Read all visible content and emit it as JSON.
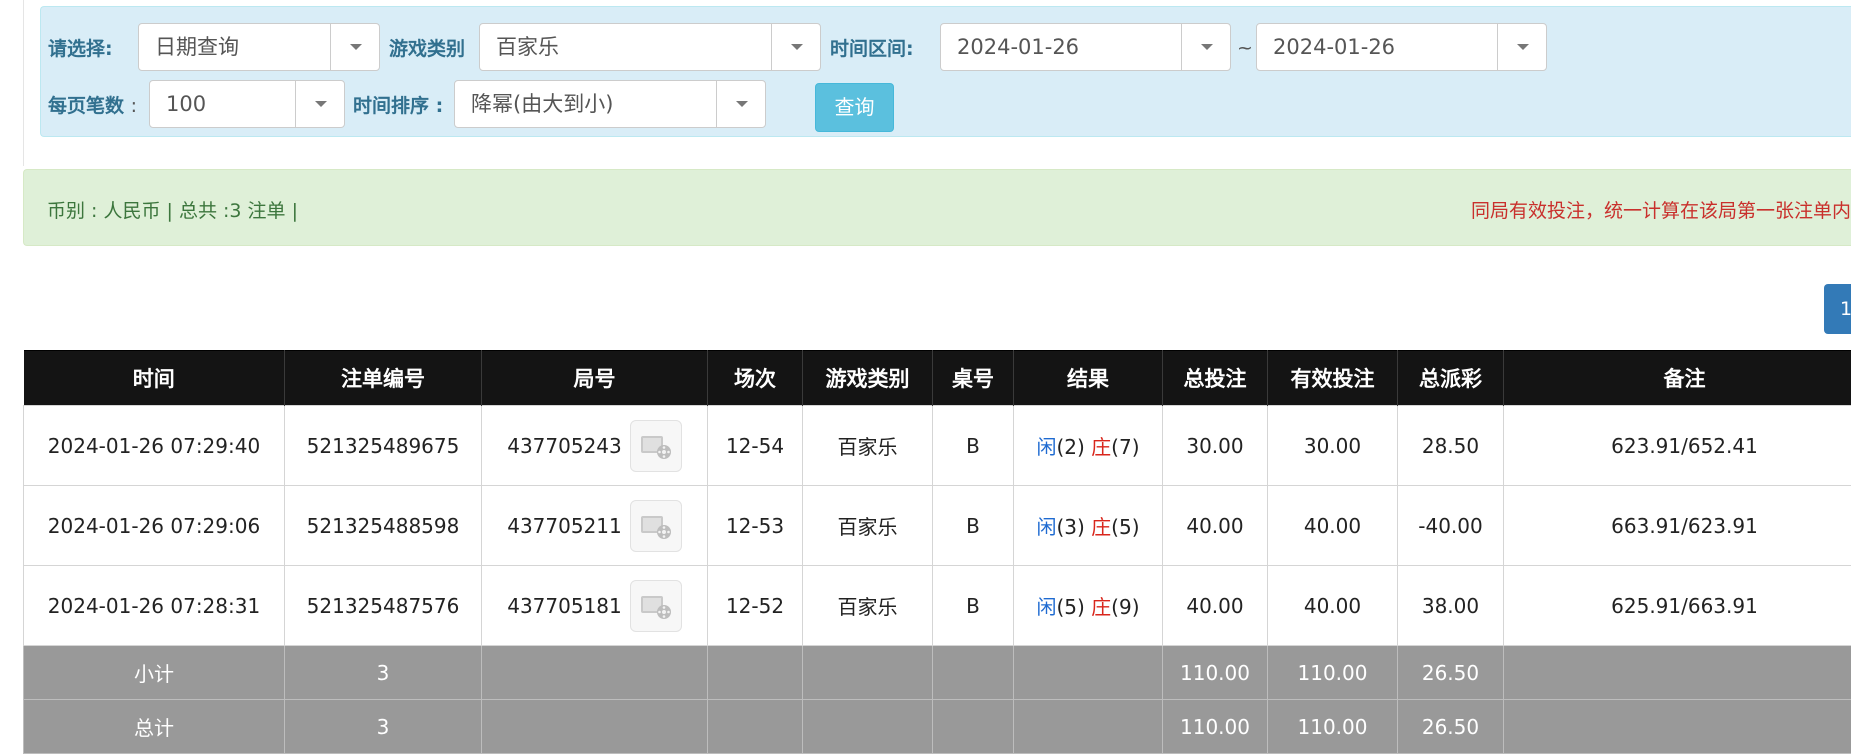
{
  "filters": {
    "select_label": "请选择:",
    "select_value": "日期查询",
    "game_type_label": "游戏类别",
    "game_type_value": "百家乐",
    "time_range_label": "时间区间:",
    "date_from": "2024-01-26",
    "tilde": "~",
    "date_to": "2024-01-26",
    "per_page_label": "每页笔数",
    "per_page_colon": ":",
    "per_page_value": "100",
    "sort_label": "时间排序 :",
    "sort_value": "降幂(由大到小)",
    "query_button": "查询"
  },
  "info": {
    "summary": "币别 : 人民币 | 总共 :3 注单 |",
    "notice": "同局有效投注，统一计算在该局第一张注单内"
  },
  "pagination": {
    "current": "1"
  },
  "table": {
    "headers": [
      "时间",
      "注单编号",
      "局号",
      "场次",
      "游戏类别",
      "桌号",
      "结果",
      "总投注",
      "有效投注",
      "总派彩",
      "备注"
    ],
    "rows": [
      {
        "time": "2024-01-26 07:29:40",
        "bet_id": "521325489675",
        "round_id": "437705243",
        "session": "12-54",
        "game": "百家乐",
        "table": "B",
        "player_label": "闲",
        "player_score": "(2)",
        "banker_label": "庄",
        "banker_score": "(7)",
        "total_bet": "30.00",
        "valid_bet": "30.00",
        "payout": "28.50",
        "note": "623.91/652.41"
      },
      {
        "time": "2024-01-26 07:29:06",
        "bet_id": "521325488598",
        "round_id": "437705211",
        "session": "12-53",
        "game": "百家乐",
        "table": "B",
        "player_label": "闲",
        "player_score": "(3)",
        "banker_label": "庄",
        "banker_score": "(5)",
        "total_bet": "40.00",
        "valid_bet": "40.00",
        "payout": "-40.00",
        "note": "663.91/623.91"
      },
      {
        "time": "2024-01-26 07:28:31",
        "bet_id": "521325487576",
        "round_id": "437705181",
        "session": "12-52",
        "game": "百家乐",
        "table": "B",
        "player_label": "闲",
        "player_score": "(5)",
        "banker_label": "庄",
        "banker_score": "(9)",
        "total_bet": "40.00",
        "valid_bet": "40.00",
        "payout": "38.00",
        "note": "625.91/663.91"
      }
    ],
    "subtotal": {
      "label": "小计",
      "count": "3",
      "total_bet": "110.00",
      "valid_bet": "110.00",
      "payout": "26.50"
    },
    "total": {
      "label": "总计",
      "count": "3",
      "total_bet": "110.00",
      "valid_bet": "110.00",
      "payout": "26.50"
    }
  },
  "icons": {
    "replay": "video-replay-icon"
  },
  "colors": {
    "panel_bg": "#d9edf7",
    "info_bg": "#dff0d8",
    "header_bg": "#141414",
    "sum_bg": "#999999",
    "query_btn": "#5bc0de",
    "page_btn": "#337ab7"
  }
}
